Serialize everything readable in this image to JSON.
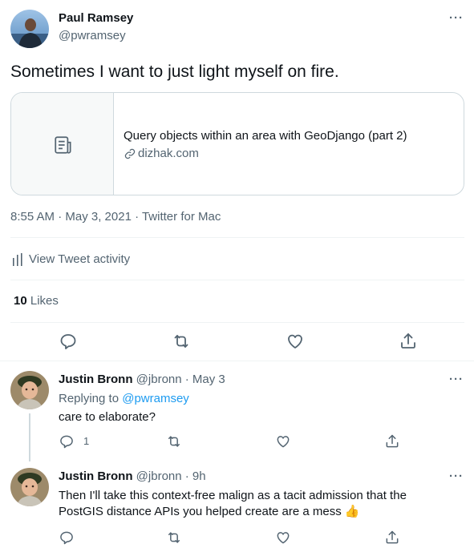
{
  "tweet": {
    "author_name": "Paul Ramsey",
    "author_handle": "@pwramsey",
    "more": "···",
    "text": "Sometimes I want to just light myself on fire.",
    "card": {
      "title": "Query objects within an area with GeoDjango (part 2)",
      "domain": "dizhak.com"
    },
    "meta": "8:55 AM · May 3, 2021 · Twitter for Mac",
    "activity_label": "View Tweet activity",
    "likes_count": "10",
    "likes_label": "Likes"
  },
  "replies": [
    {
      "name": "Justin Bronn",
      "handle_time": "@jbronn · May 3",
      "replying_prefix": "Replying to",
      "replying_to": "@pwramsey",
      "text": "care to elaborate?",
      "reply_count": "1",
      "more": "···"
    },
    {
      "name": "Justin Bronn",
      "handle_time": "@jbronn · 9h",
      "text_line1": "Then I'll take this context-free malign as a tacit admission that the",
      "text_line2": "PostGIS distance APIs you helped create are a mess",
      "emoji": "👍",
      "more": "···"
    }
  ],
  "colors": {
    "text": "#0f1419",
    "muted": "#536471",
    "link": "#1d9bf0",
    "border": "#cfd9de",
    "divider": "#eff3f4",
    "card_bg": "#f7f9f9"
  }
}
